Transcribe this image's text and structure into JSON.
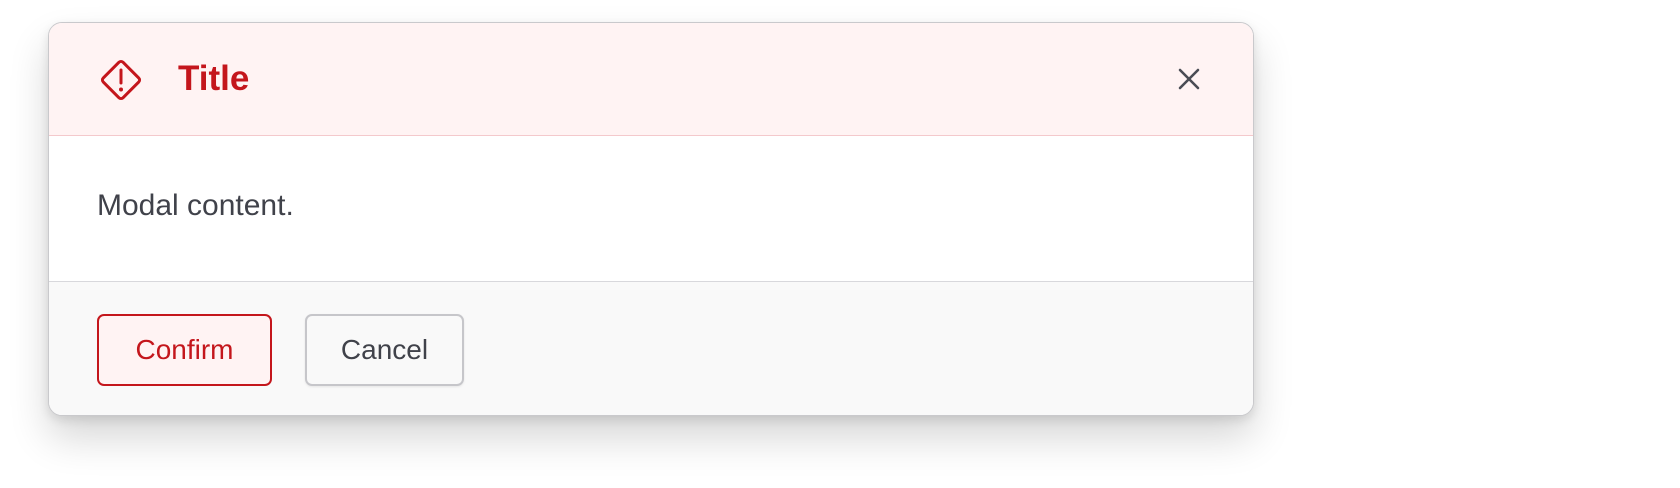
{
  "modal": {
    "title": "Title",
    "header_icon": "warning-diamond-icon",
    "close_icon": "close-icon",
    "body_text": "Modal content.",
    "confirm_label": "Confirm",
    "cancel_label": "Cancel",
    "colors": {
      "accent": "#c4161c",
      "header_background": "#fff3f3",
      "text": "#40424a",
      "footer_background": "#f9f9f9"
    }
  }
}
